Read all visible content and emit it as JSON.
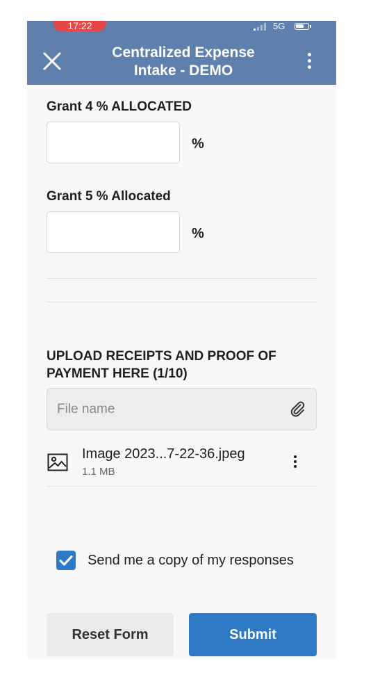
{
  "status_bar": {
    "time": "17:22",
    "network": "5G"
  },
  "header": {
    "title_line1": "Centralized Expense",
    "title_line2": "Intake - DEMO"
  },
  "form": {
    "grant4": {
      "label": "Grant 4 % ALLOCATED",
      "value": "",
      "suffix": "%"
    },
    "grant5": {
      "label": "Grant 5 % Allocated",
      "value": "",
      "suffix": "%"
    },
    "upload": {
      "label_line1": "UPLOAD RECEIPTS AND PROOF OF",
      "label_line2": "PAYMENT HERE (1/10)",
      "placeholder": "File name",
      "files": [
        {
          "name": "Image 2023...7-22-36.jpeg",
          "size": "1.1 MB",
          "icon": "image-icon"
        }
      ]
    },
    "send_copy": {
      "label": "Send me a copy of my responses",
      "checked": true
    },
    "reset_label": "Reset Form",
    "submit_label": "Submit"
  },
  "colors": {
    "header": "#5f80ad",
    "accent": "#2f78c4",
    "clock_pill": "#e64747"
  }
}
